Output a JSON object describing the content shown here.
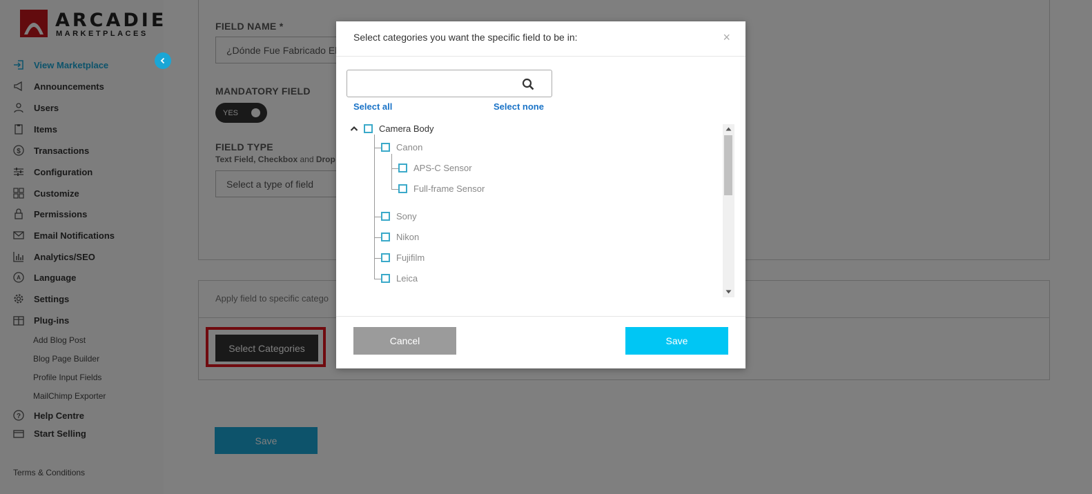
{
  "sidebar": {
    "logo_line1": "ARCADIER",
    "logo_line2": "MARKETPLACES",
    "items": [
      {
        "label": "View Marketplace",
        "icon": "enter-icon"
      },
      {
        "label": "Announcements",
        "icon": "megaphone-icon"
      },
      {
        "label": "Users",
        "icon": "user-icon"
      },
      {
        "label": "Items",
        "icon": "clipboard-icon"
      },
      {
        "label": "Transactions",
        "icon": "dollar-icon"
      },
      {
        "label": "Configuration",
        "icon": "sliders-icon"
      },
      {
        "label": "Customize",
        "icon": "grid-icon"
      },
      {
        "label": "Permissions",
        "icon": "lock-icon"
      },
      {
        "label": "Email Notifications",
        "icon": "mail-icon"
      },
      {
        "label": "Analytics/SEO",
        "icon": "bar-chart-icon"
      },
      {
        "label": "Language",
        "icon": "language-icon"
      },
      {
        "label": "Settings",
        "icon": "gear-icon"
      },
      {
        "label": "Plug-ins",
        "icon": "plugin-icon"
      },
      {
        "label": "Help Centre",
        "icon": "help-icon"
      },
      {
        "label": "Start Selling",
        "icon": "store-icon"
      }
    ],
    "sub_items": [
      "Add Blog Post",
      "Blog Page Builder",
      "Profile Input Fields",
      "MailChimp Exporter"
    ],
    "terms": "Terms & Conditions"
  },
  "form": {
    "field_name_label": "FIELD NAME *",
    "field_name_value": "¿Dónde Fue Fabricado El",
    "mandatory_label": "MANDATORY FIELD",
    "toggle_label": "YES",
    "field_type_label": "FIELD TYPE",
    "field_type_help_1": "Text Field, Checkbox",
    "field_type_help_2": " and ",
    "field_type_help_3": "Drop",
    "field_type_placeholder": "Select a type of field",
    "apply_label": "Apply field to specific catego",
    "select_categories": "Select Categories",
    "save": "Save"
  },
  "modal": {
    "title": "Select categories you want the specific field to be in:",
    "close": "×",
    "search_value": "",
    "select_all": "Select all",
    "select_none": "Select none",
    "tree": [
      {
        "label": "Camera Body"
      },
      {
        "label": "Canon"
      },
      {
        "label": "APS-C Sensor"
      },
      {
        "label": "Full-frame Sensor"
      },
      {
        "label": "Sony"
      },
      {
        "label": "Nikon"
      },
      {
        "label": "Fujifilm"
      },
      {
        "label": "Leica"
      }
    ],
    "cancel": "Cancel",
    "save": "Save"
  },
  "colors": {
    "accent": "#1aa6d6",
    "save_modal": "#00c6f4",
    "cancel": "#9b9b9b",
    "highlight": "#e0161e",
    "checkbox": "#3aa9c9"
  }
}
